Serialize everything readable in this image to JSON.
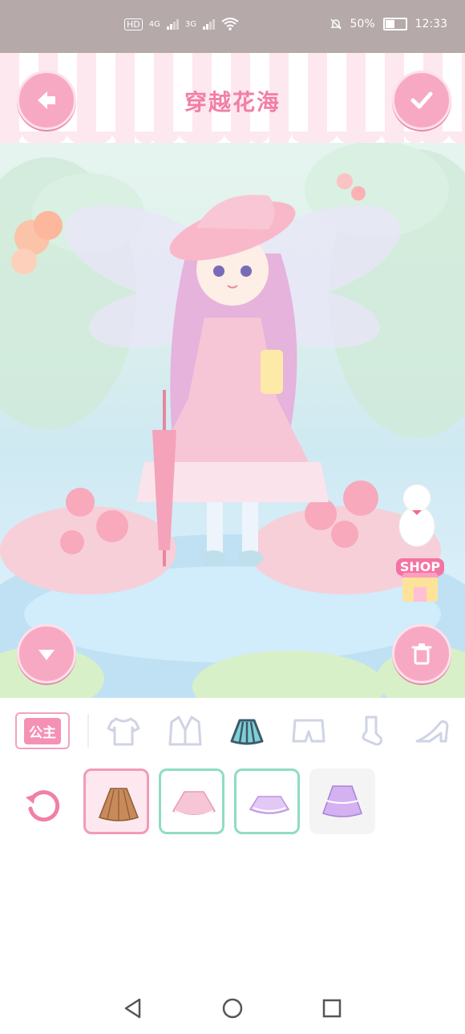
{
  "status_bar": {
    "hd_badge": "HD",
    "sim1_label": "4G",
    "sim2_label": "3G",
    "battery_percent": "50%",
    "battery_level": 0.5,
    "time": "12:33",
    "icons": [
      "hd-icon",
      "signal-icon",
      "wifi-icon",
      "mute-icon",
      "battery-icon"
    ]
  },
  "header": {
    "title": "穿越花海",
    "back_icon": "back-arrow-icon",
    "confirm_icon": "checkmark-icon"
  },
  "scene": {
    "shop_label": "SHOP",
    "collapse_icon": "chevron-down-icon",
    "trash_icon": "trash-icon"
  },
  "category_bar": {
    "princess_label": "公主",
    "categories": [
      {
        "name": "tops",
        "icon": "tshirt-icon"
      },
      {
        "name": "outerwear",
        "icon": "jacket-icon"
      },
      {
        "name": "skirts",
        "icon": "skirt-icon",
        "selected": true
      },
      {
        "name": "pants",
        "icon": "shorts-icon"
      },
      {
        "name": "socks",
        "icon": "sock-icon"
      },
      {
        "name": "shoes",
        "icon": "heel-shoe-icon"
      }
    ]
  },
  "items": {
    "reset_icon": "refresh-icon",
    "list": [
      {
        "name": "brown-pleated-skirt",
        "state": "selected",
        "color": "#c88a5a"
      },
      {
        "name": "pink-tutu-skirt",
        "state": "owned",
        "color": "#f7c6d6"
      },
      {
        "name": "lavender-ruffle-skirt",
        "state": "owned",
        "color": "#d7b8f0"
      },
      {
        "name": "purple-layered-skirt",
        "state": "locked",
        "color": "#c9a4ee"
      }
    ]
  },
  "colors": {
    "accent_pink": "#f7a9c3",
    "title_pink": "#f27fa6",
    "selected_border": "#f29ab9",
    "owned_border": "#8fdcc4"
  }
}
